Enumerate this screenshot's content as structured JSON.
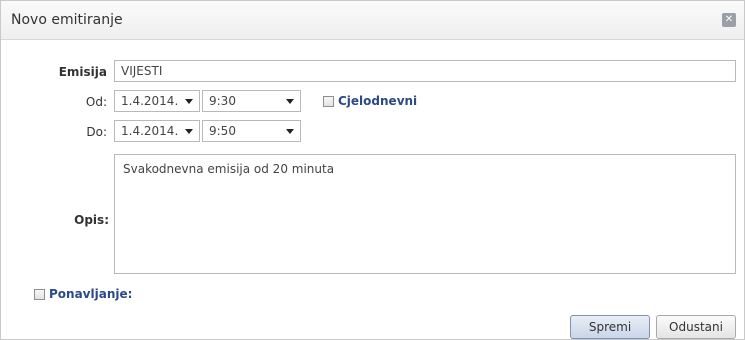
{
  "dialog": {
    "title": "Novo emitiranje",
    "close_icon": "close-icon"
  },
  "form": {
    "emisija": {
      "label": "Emisija",
      "value": "VIJESTI"
    },
    "od": {
      "label": "Od:",
      "date": "1.4.2014.",
      "time": "9:30"
    },
    "do": {
      "label": "Do:",
      "date": "1.4.2014.",
      "time": "9:50"
    },
    "cjelodnevni": {
      "label": "Cjelodnevni",
      "checked": false
    },
    "opis": {
      "label": "Opis:",
      "value": "Svakodnevna emisija od 20 minuta"
    },
    "ponavljanje": {
      "label": "Ponavljanje:",
      "checked": false
    }
  },
  "buttons": {
    "save": "Spremi",
    "cancel": "Odustani"
  }
}
